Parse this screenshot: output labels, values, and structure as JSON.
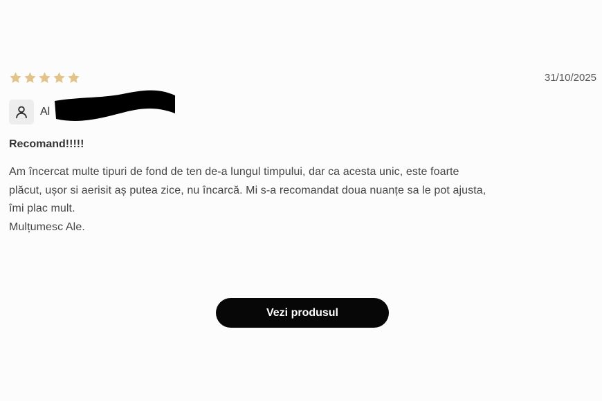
{
  "review": {
    "rating": 5,
    "max_rating": 5,
    "star_color": "#e2c48b",
    "date": "31/10/2025",
    "author": "Al",
    "author_redacted": true,
    "title": "Recomand!!!!!",
    "body_lines": [
      "Am încercat multe tipuri de fond de ten de-a lungul timpului, dar ca acesta unic, este foarte",
      "plăcut, ușor si aerisit aș putea zice, nu încarcă. Mi s-a recomandat doua nuanțe sa le pot ajusta,",
      "îmi plac mult.",
      "Mulțumesc Ale."
    ]
  },
  "cta": {
    "label": "Vezi produsul",
    "bg_color": "#070707"
  }
}
